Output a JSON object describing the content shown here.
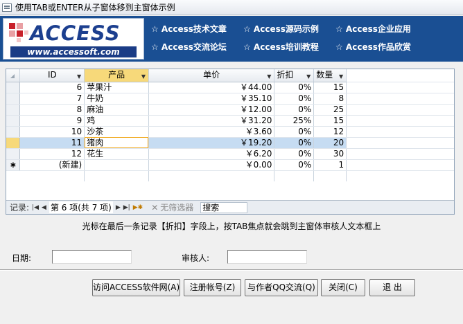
{
  "window": {
    "title": "使用TAB或ENTER从子窗体移到主窗体示例"
  },
  "banner": {
    "logo_word": "ACCESS",
    "logo_url": "www.accessoft.com",
    "links": [
      "☆ Access技术文章",
      "☆ Access源码示例",
      "☆ Access企业应用",
      "☆ Access交流论坛",
      "☆ Access培训教程",
      "☆ Access作品欣赏"
    ]
  },
  "table": {
    "columns": [
      "ID",
      "产品",
      "单价",
      "折扣",
      "数量"
    ],
    "rows": [
      {
        "id": "6",
        "product": "苹果汁",
        "price": "￥44.00",
        "discount": "0%",
        "qty": "15"
      },
      {
        "id": "7",
        "product": "牛奶",
        "price": "￥35.10",
        "discount": "0%",
        "qty": "8"
      },
      {
        "id": "8",
        "product": "麻油",
        "price": "￥12.00",
        "discount": "0%",
        "qty": "25"
      },
      {
        "id": "9",
        "product": "鸡",
        "price": "￥31.20",
        "discount": "25%",
        "qty": "15"
      },
      {
        "id": "10",
        "product": "沙茶",
        "price": "￥3.60",
        "discount": "0%",
        "qty": "12"
      },
      {
        "id": "11",
        "product": "猪肉",
        "price": "￥19.20",
        "discount": "0%",
        "qty": "20"
      },
      {
        "id": "12",
        "product": "花生",
        "price": "￥6.20",
        "discount": "0%",
        "qty": "30"
      }
    ],
    "new_row": {
      "marker": "∗",
      "id": "(新建)",
      "price": "￥0.00",
      "discount": "0%",
      "qty": "1"
    }
  },
  "nav": {
    "label": "记录:",
    "first": "|◀",
    "prev": "◀",
    "record": "第 6 项(共 7 项)",
    "next": "▶",
    "last": "▶|",
    "new": "▶✱",
    "filter_icon": "✕",
    "filter": "无筛选器",
    "search": "搜索"
  },
  "hint": "光标在最后一条记录【折扣】字段上，按TAB焦点就会跳到主窗体审核人文本框上",
  "form": {
    "date_label": "日期:",
    "reviewer_label": "审核人:"
  },
  "buttons": {
    "visit": "访问ACCESS软件网(A)",
    "register": "注册帐号(Z)",
    "qq": "与作者QQ交流(Q)",
    "close": "关闭(C)",
    "exit": "退 出"
  },
  "colors": {
    "banner_bg": "#1a4f93",
    "selection": "#c6dcf2",
    "header_selected": "#f7d97a"
  }
}
